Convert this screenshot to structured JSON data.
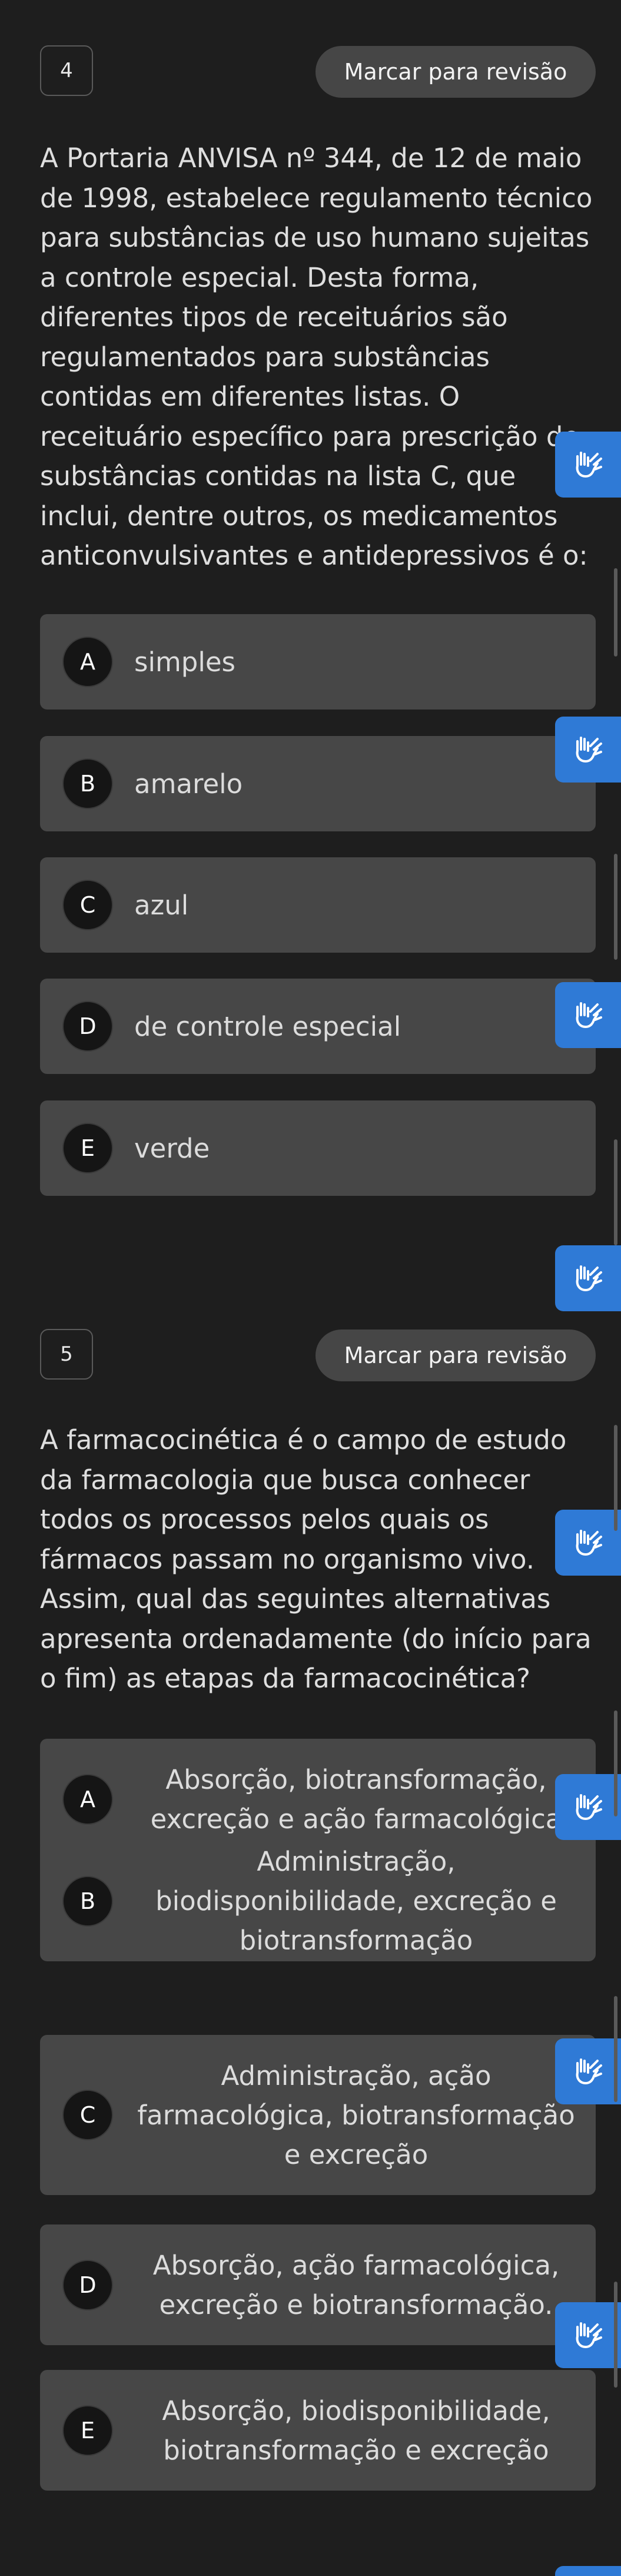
{
  "review_label": "Marcar para revisão",
  "questions": [
    {
      "number": "4",
      "text": "A Portaria ANVISA nº 344, de 12 de maio de 1998, estabelece regulamento técnico para substâncias de uso humano sujeitas a controle especial. Desta forma, diferentes tipos de receituários são regulamentados para substâncias contidas em diferentes listas. O receituário específico para prescrição de substâncias contidas na lista C, que inclui, dentre outros, os medicamentos anticonvulsivantes e antidepressivos é o:",
      "options": [
        {
          "letter": "A",
          "text": "simples"
        },
        {
          "letter": "B",
          "text": "amarelo"
        },
        {
          "letter": "C",
          "text": "azul"
        },
        {
          "letter": "D",
          "text": "de controle especial"
        },
        {
          "letter": "E",
          "text": "verde"
        }
      ]
    },
    {
      "number": "5",
      "text": "A farmacocinética é o campo de estudo da farmacologia que busca conhecer todos os processos pelos quais os fármacos passam no organismo vivo. Assim, qual das seguintes alternativas apresenta ordenadamente (do início para o fim) as etapas da farmacocinética?",
      "options": [
        {
          "letter": "A",
          "text": "Absorção, biotransformação, excreção e ação farmacológica"
        },
        {
          "letter": "B",
          "text": "Administração, biodisponibilidade, excreção e biotransformação"
        },
        {
          "letter": "C",
          "text": "Administração, ação farmacológica, biotransformação e excreção"
        },
        {
          "letter": "D",
          "text": "Absorção, ação farmacológica, excreção e biotransformação."
        },
        {
          "letter": "E",
          "text": "Absorção, biodisponibilidade, biotransformação e excreção"
        }
      ]
    }
  ],
  "accessibility_icon": "sign-language-hand-icon",
  "colors": {
    "background": "#1e1e1e",
    "option_bg": "#474747",
    "accent": "#2f7ad6"
  }
}
